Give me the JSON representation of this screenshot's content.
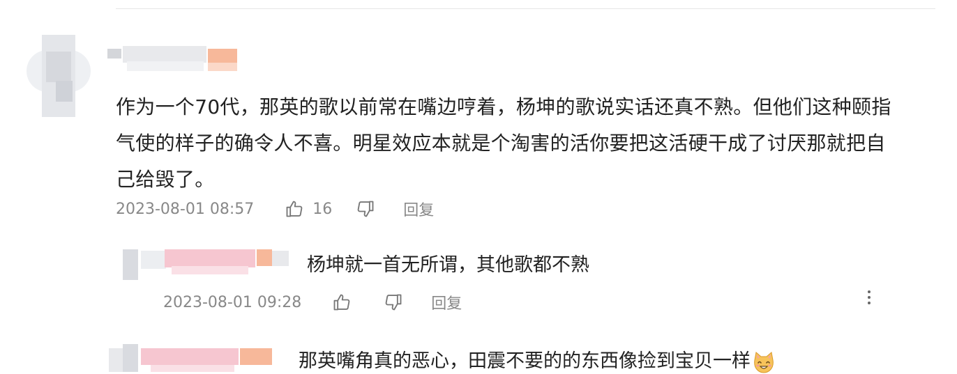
{
  "comment": {
    "text_lines": [
      "作为一个70代，那英的歌以前常在嘴边哼着，杨坤的歌说实话还真不熟。但他们这种颐指",
      "气使的样子的确令人不喜。明星效应本就是个淘害的活你要把这活硬干成了讨厌那就把自",
      "己给毁了。"
    ],
    "timestamp": "2023-08-01 08:57",
    "like_count": "16",
    "reply_label": "回复"
  },
  "replies": [
    {
      "text": "杨坤就一首无所谓，其他歌都不熟",
      "timestamp": "2023-08-01 09:28",
      "reply_label": "回复"
    },
    {
      "text": "那英嘴角真的恶心，田震不要的的东西像捡到宝贝一样"
    }
  ],
  "icons": {
    "like": "thumbs-up-icon",
    "dislike": "thumbs-down-icon",
    "more": "more-vertical-icon",
    "emoji": "cat-smile-emoji-icon"
  },
  "colors": {
    "text": "#222222",
    "meta": "#888888",
    "blur_orange": "#f7b89a",
    "blur_pink": "#f6c6d0",
    "blur_gray": "#d9dbe0"
  }
}
